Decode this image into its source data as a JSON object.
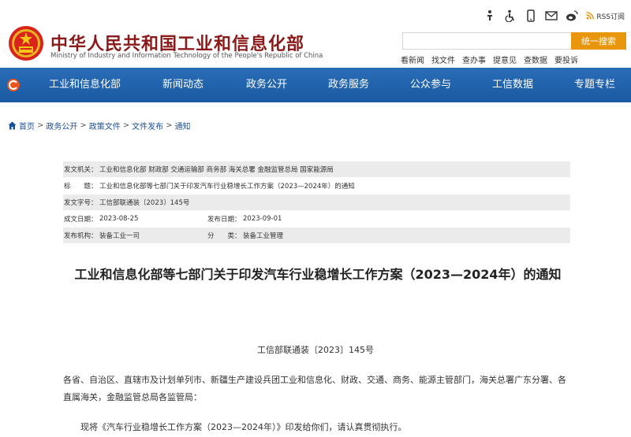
{
  "header": {
    "title": "中华人民共和国工业和信息化部",
    "subtitle": "Ministry of Industry and Information Technology of the People's Republic of China",
    "rss_label": "RSS订阅",
    "search": {
      "placeholder": "",
      "button_label": "统一搜索"
    },
    "quick_links": [
      "看新闻",
      "找文件",
      "查办事",
      "提意见",
      "查数据",
      "要投诉"
    ]
  },
  "nav": {
    "items": [
      "工业和信息化部",
      "新闻动态",
      "政务公开",
      "政务服务",
      "公众参与",
      "工信数据",
      "专题专栏"
    ]
  },
  "breadcrumb": [
    "首页",
    "政务公开",
    "政策文件",
    "文件发布",
    "通知"
  ],
  "info": {
    "issuer_label": "发文机关：",
    "issuer_value": "工业和信息化部 财政部 交通运输部 商务部 海关总署 金融监管总局 国家能源局",
    "title_label": "标　　题：",
    "title_value": "工业和信息化部等七部门关于印发汽车行业稳增长工作方案（2023—2024年）的通知",
    "docno_label": "发文字号：",
    "docno_value": "工信部联通装〔2023〕145号",
    "created_label": "成文日期：",
    "created_value": "2023-08-25",
    "published_label": "发布日期：",
    "published_value": "2023-09-01",
    "agency_label": "发布机构：",
    "agency_value": "装备工业一司",
    "category_label": "分　　类：",
    "category_value": "装备工业管理"
  },
  "doc": {
    "title": "工业和信息化部等七部门关于印发汽车行业稳增长工作方案（2023—2024年）的通知",
    "number": "工信部联通装〔2023〕145号",
    "para1": "各省、自治区、直辖市及计划单列市、新疆生产建设兵团工业和信息化、财政、交通、商务、能源主管部门，海关总署广东分署、各直属海关，金融监管总局各监管局：",
    "para2": "现将《汽车行业稳增长工作方案（2023—2024年）》印发给你们，请认真贯彻执行。"
  },
  "colors": {
    "brand_red": "#8b1a1a",
    "nav_blue": "#1c5fa9",
    "search_orange": "#e8960c",
    "link_blue": "#1a4f99"
  }
}
